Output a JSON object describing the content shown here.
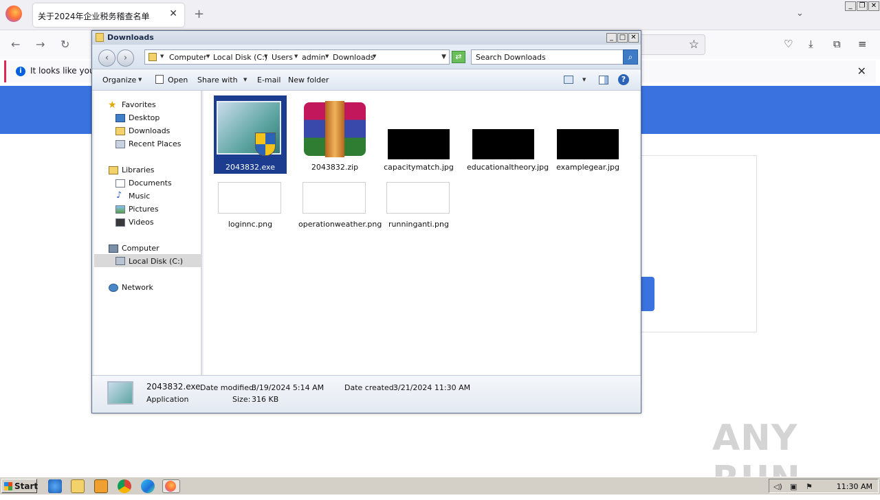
{
  "browser": {
    "tab_title": "关于2024年企业税务稽查名单",
    "tab_close": "✕",
    "new_tab": "+",
    "notice_text": "It looks like you ha",
    "notice_close": "✕"
  },
  "window": {
    "title": "Downloads",
    "min": "_",
    "max": "□",
    "close": "✕"
  },
  "breadcrumb": [
    "Computer",
    "Local Disk (C:)",
    "Users",
    "admin",
    "Downloads"
  ],
  "search": {
    "placeholder": "Search Downloads"
  },
  "toolbar": {
    "organize": "Organize",
    "open": "Open",
    "share": "Share with",
    "email": "E-mail",
    "new_folder": "New folder"
  },
  "nav": {
    "favorites": "Favorites",
    "desktop": "Desktop",
    "downloads": "Downloads",
    "recent": "Recent Places",
    "libraries": "Libraries",
    "documents": "Documents",
    "music": "Music",
    "pictures": "Pictures",
    "videos": "Videos",
    "computer": "Computer",
    "local_disk": "Local Disk (C:)",
    "network": "Network"
  },
  "files": [
    {
      "name": "2043832.exe",
      "selected": true
    },
    {
      "name": "2043832.zip"
    },
    {
      "name": "capacitymatch.jpg"
    },
    {
      "name": "educationaltheory.jpg"
    },
    {
      "name": "examplegear.jpg"
    },
    {
      "name": "loginnc.png"
    },
    {
      "name": "operationweather.png"
    },
    {
      "name": "runninganti.png"
    }
  ],
  "details": {
    "filename": "2043832.exe",
    "type": "Application",
    "modified_label": "Date modified:",
    "modified": "3/19/2024 5:14 AM",
    "created_label": "Date created:",
    "created": "3/21/2024 11:30 AM",
    "size_label": "Size:",
    "size": "316 KB"
  },
  "taskbar": {
    "start": "Start",
    "clock": "11:30 AM"
  },
  "watermark": "ANY RUN"
}
